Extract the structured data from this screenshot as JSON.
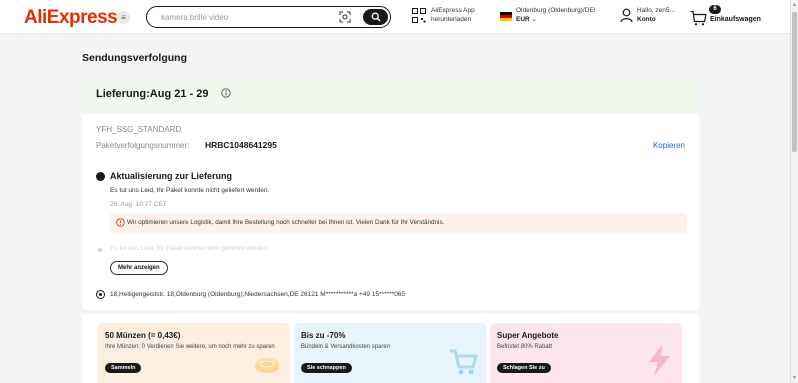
{
  "header": {
    "logo": "AliExpress",
    "menu_icon": "menu-icon",
    "search": {
      "placeholder": "kamera brille video"
    },
    "app_download": {
      "line1": "AliExpress App",
      "line2": "herunterladen"
    },
    "region": {
      "line1": "Oldenburg (Oldenburg)/DE/",
      "currency": "EUR"
    },
    "account": {
      "greeting": "Hallo, zen5...",
      "label": "Konto"
    },
    "cart": {
      "count": "6",
      "label": "Einkaufswagen"
    }
  },
  "page": {
    "title": "Sendungsverfolgung",
    "delivery": "Lieferung:Aug 21 - 29",
    "tracking": {
      "carrier": "YFH_SSG_STANDARD",
      "number_label": "Paketverfolgungsnummer:",
      "number": "HRBC1048641295",
      "copy_label": "Kopieren",
      "update_title": "Aktualisierung zur Lieferung",
      "update_message": "Es tut uns Leid, Ihr Paket konnte nicht geliefert werden.",
      "update_time": "26. Aug. 10:27 CET",
      "notice": "Wir optimieren unsere Logistik, damit Ihre Bestellung noch schneller bei Ihnen ist. Vielen Dank für Ihr Verständnis.",
      "faded_event": "Es tut uns Leid, Ihr Paket konnte nicht geliefert werden.",
      "more_label": "Mehr anzeigen",
      "address": "18,Heiligengeiststr. 18,Oldenburg (Oldenburg),Niedersachsen,DE 26121 M***********a +49 15******065"
    },
    "promos": [
      {
        "title": "50 Münzen (= 0,43€)",
        "desc": "Ihre Münzen: 0 Verdienen Sie weitere, um noch mehr zu sparen",
        "button": "Sammeln"
      },
      {
        "title": "Bis zu -70%",
        "desc": "Bündeln & Versandkosten sparen",
        "button": "Sie schnappen"
      },
      {
        "title": "Super Angebote",
        "desc": "Befristet 80% Rabatt",
        "button": "Schlagen Sie zu"
      }
    ]
  },
  "colors": {
    "brand": "#e62e04",
    "link": "#1a6bd8",
    "delivery_bg": "#f2f8ee",
    "notice_bg": "#fdf3ec"
  }
}
